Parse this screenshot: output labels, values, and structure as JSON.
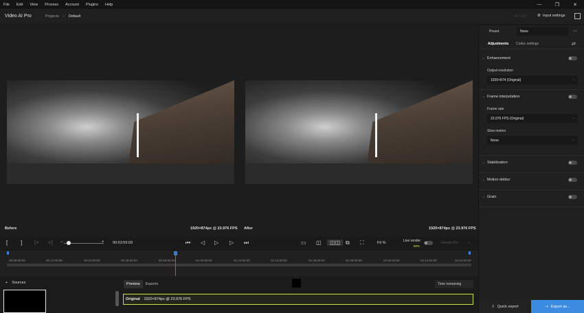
{
  "menu": [
    "File",
    "Edit",
    "View",
    "Process",
    "Account",
    "Plugins",
    "Help"
  ],
  "app": {
    "name": "Video AI Pro",
    "version": "v5.7.0.0"
  },
  "breadcrumb": {
    "root": "Projects",
    "current": "Default"
  },
  "header": {
    "input_settings": "Input settings"
  },
  "viewer": {
    "before_label": "Before",
    "before_info": "1920×874px @ 23.976 FPS",
    "after_label": "After",
    "after_info": "1920×874px @ 23.976 FPS"
  },
  "controls": {
    "timecode": "00:53:59:09",
    "fit": "Fit %",
    "live_render": "Live render",
    "live_pct": "60%",
    "render_btn": "Render Ifrs"
  },
  "timeline": {
    "ticks": [
      "00:00:00:00",
      "00:12:00:00",
      "00:24:00:00",
      "00:36:00:00",
      "00:48:00:00",
      "01:00:00:00",
      "01:12:00:00",
      "01:24:00:00",
      "01:36:00:00",
      "01:48:00:00",
      "02:00:00:00",
      "02:12:00:00",
      "02:24:00:00"
    ]
  },
  "bottom": {
    "sources": "Sources",
    "add": "+",
    "tab_preview": "Preview",
    "tab_exports": "Exports",
    "time_remaining": "Time remaining",
    "row_label": "Original",
    "row_info": "1920×874px @ 23.976 FPS"
  },
  "panel": {
    "preset_label": "Preset",
    "preset_value": "None",
    "tab_adjustments": "Adjustments",
    "tab_codec": "Codec settings",
    "enhancement": "Enhancement",
    "output_resolution_label": "Output resolution",
    "output_resolution": "1920×874 (Original)",
    "frame_interpolation": "Frame interpolation",
    "frame_rate_label": "Frame rate",
    "frame_rate": "23.976 FPS (Original)",
    "slow_motion_label": "Slow motion",
    "slow_motion": "None",
    "stabilization": "Stabilization",
    "motion_deblur": "Motion deblur",
    "grain": "Grain"
  },
  "footer": {
    "quick_export": "Quick export",
    "export_as": "Export as..."
  },
  "colors": {
    "accent": "#3b8be0",
    "playhead": "#3a7bd5",
    "selection": "#c7e24a"
  }
}
